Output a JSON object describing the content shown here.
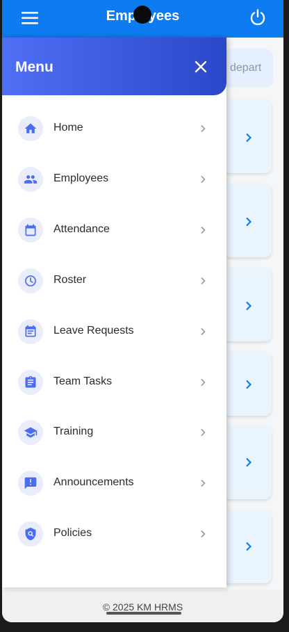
{
  "appbar": {
    "title": "Employees"
  },
  "background": {
    "search_placeholder_fragment": "depart"
  },
  "drawer": {
    "title": "Menu",
    "items": [
      {
        "label": "Home",
        "icon": "home-icon"
      },
      {
        "label": "Employees",
        "icon": "people-icon"
      },
      {
        "label": "Attendance",
        "icon": "calendar-icon"
      },
      {
        "label": "Roster",
        "icon": "clock-icon"
      },
      {
        "label": "Leave Requests",
        "icon": "event-note-icon"
      },
      {
        "label": "Team Tasks",
        "icon": "clipboard-icon"
      },
      {
        "label": "Training",
        "icon": "graduation-cap-icon"
      },
      {
        "label": "Announcements",
        "icon": "announcement-icon"
      },
      {
        "label": "Policies",
        "icon": "policy-shield-icon"
      }
    ]
  },
  "footer": {
    "copyright": "© 2025 KM HRMS"
  },
  "colors": {
    "appbar": "#0d7cf2",
    "drawer_header_start": "#4f6ff5",
    "drawer_header_end": "#2b47c9",
    "menu_icon": "#4a6cf0",
    "card_bg": "#eaf4fd"
  }
}
